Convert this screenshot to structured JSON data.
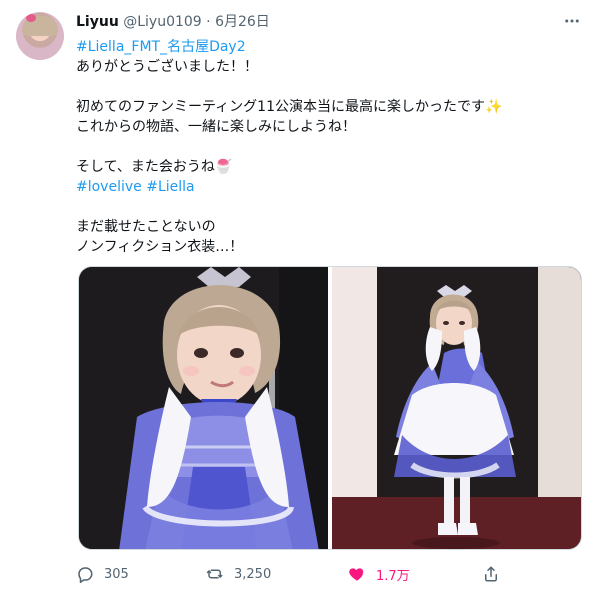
{
  "tweet": {
    "author": {
      "name": "Liyuu",
      "handle": "@Liyu0109",
      "separator": "·",
      "date": "6月26日"
    },
    "lines": {
      "hashtag_line": "#Liella_FMT_名古屋Day2",
      "l1": "ありがとうございました！！",
      "l2": "初めてのファンミーティング11公演本当に最高に楽しかったです✨",
      "l3": "これからの物語、一緒に楽しみにしようね！",
      "l4": "そして、また会おうね🍧",
      "tag1": "#lovelive",
      "tag2": "#Liella",
      "l5": "まだ載せたことないの",
      "l6": "ノンフィクション衣装…！"
    },
    "counts": {
      "replies": "305",
      "retweets": "3,250",
      "likes": "1.7万"
    },
    "more_icon": "more-horizontal-icon",
    "colors": {
      "link": "#1d9bf0",
      "like": "#f91880",
      "secondary": "#536471"
    }
  }
}
